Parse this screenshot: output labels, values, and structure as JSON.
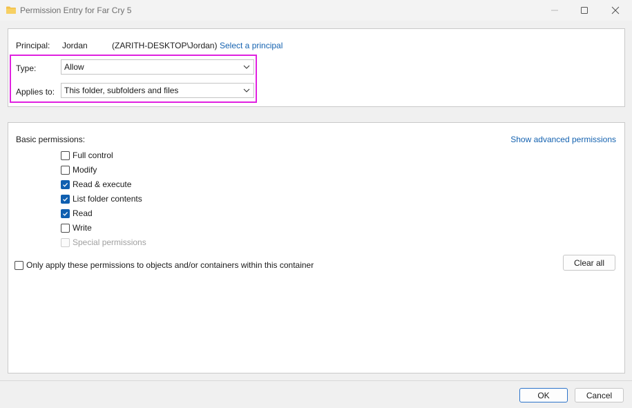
{
  "window": {
    "title": "Permission Entry for Far Cry 5"
  },
  "principal": {
    "label": "Principal:",
    "name": "Jordan",
    "account": "(ZARITH-DESKTOP\\Jordan)",
    "select_link": "Select a principal"
  },
  "type": {
    "label": "Type:",
    "value": "Allow"
  },
  "applies_to": {
    "label": "Applies to:",
    "value": "This folder, subfolders and files"
  },
  "basic_permissions": {
    "label": "Basic permissions:",
    "advanced_link": "Show advanced permissions",
    "items": [
      {
        "label": "Full control",
        "checked": false,
        "disabled": false
      },
      {
        "label": "Modify",
        "checked": false,
        "disabled": false
      },
      {
        "label": "Read & execute",
        "checked": true,
        "disabled": false
      },
      {
        "label": "List folder contents",
        "checked": true,
        "disabled": false
      },
      {
        "label": "Read",
        "checked": true,
        "disabled": false
      },
      {
        "label": "Write",
        "checked": false,
        "disabled": false
      },
      {
        "label": "Special permissions",
        "checked": false,
        "disabled": true
      }
    ]
  },
  "only_apply": {
    "label": "Only apply these permissions to objects and/or containers within this container",
    "checked": false
  },
  "buttons": {
    "clear_all": "Clear all",
    "ok": "OK",
    "cancel": "Cancel"
  },
  "colors": {
    "link": "#1462b0",
    "highlight": "#e020e0",
    "check": "#0f5fb0"
  }
}
